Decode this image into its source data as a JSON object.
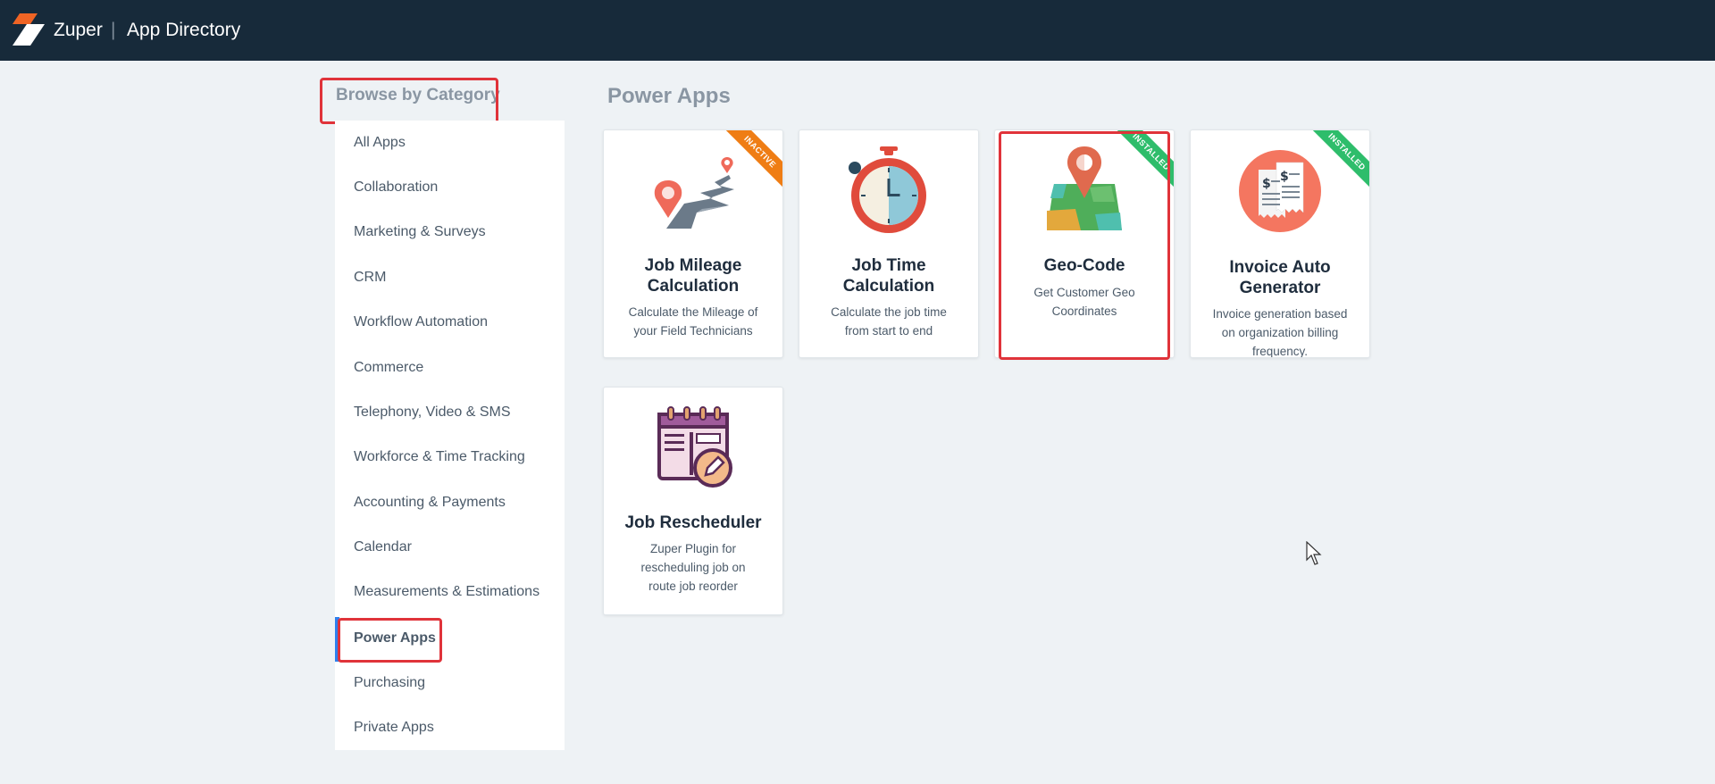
{
  "header": {
    "brand": "Zuper",
    "separator": "|",
    "title": "App Directory"
  },
  "sidebar": {
    "heading": "Browse by Category",
    "items": [
      {
        "label": "All Apps"
      },
      {
        "label": "Collaboration"
      },
      {
        "label": "Marketing & Surveys"
      },
      {
        "label": "CRM"
      },
      {
        "label": "Workflow Automation"
      },
      {
        "label": "Commerce"
      },
      {
        "label": "Telephony, Video & SMS"
      },
      {
        "label": "Workforce & Time Tracking"
      },
      {
        "label": "Accounting & Payments"
      },
      {
        "label": "Calendar"
      },
      {
        "label": "Measurements & Estimations"
      },
      {
        "label": "Power Apps",
        "active": true
      },
      {
        "label": "Purchasing"
      },
      {
        "label": "Private Apps"
      }
    ]
  },
  "main": {
    "title": "Power Apps",
    "cards": [
      {
        "title": "Job Mileage Calculation",
        "title_l1": "Job Mileage",
        "title_l2": "Calculation",
        "desc_l1": "Calculate the Mileage of",
        "desc_l2": "your Field Technicians",
        "ribbon": "INACTIVE",
        "ribbon_color": "#ef7d14",
        "icon": "map-route-icon"
      },
      {
        "title": "Job Time Calculation",
        "title_l1": "Job Time",
        "title_l2": "Calculation",
        "desc_l1": "Calculate the job time",
        "desc_l2": "from start to end",
        "ribbon": "",
        "icon": "stopwatch-icon"
      },
      {
        "title": "Geo-Code",
        "title_l1": "Geo-Code",
        "desc_l1": "Get Customer Geo",
        "desc_l2": "Coordinates",
        "ribbon": "INSTALLED",
        "ribbon_color": "#2ebd6b",
        "icon": "map-pin-icon"
      },
      {
        "title": "Invoice Auto Generator",
        "title_l1": "Invoice Auto",
        "title_l2": "Generator",
        "desc_l1": "Invoice generation based",
        "desc_l2": "on organization billing",
        "desc_l3": "frequency.",
        "ribbon": "INSTALLED",
        "ribbon_color": "#2ebd6b",
        "icon": "invoice-icon"
      },
      {
        "title": "Job Rescheduler",
        "title_l1": "Job Rescheduler",
        "desc_l1": "Zuper Plugin for",
        "desc_l2": "rescheduling job on",
        "desc_l3": "route job reorder",
        "ribbon": "",
        "icon": "calendar-edit-icon"
      }
    ]
  },
  "colors": {
    "topbar": "#172a3a",
    "highlight": "#e0333a",
    "active_bar": "#2f80ed",
    "inactive_ribbon": "#ef7d14",
    "installed_ribbon": "#2ebd6b"
  }
}
